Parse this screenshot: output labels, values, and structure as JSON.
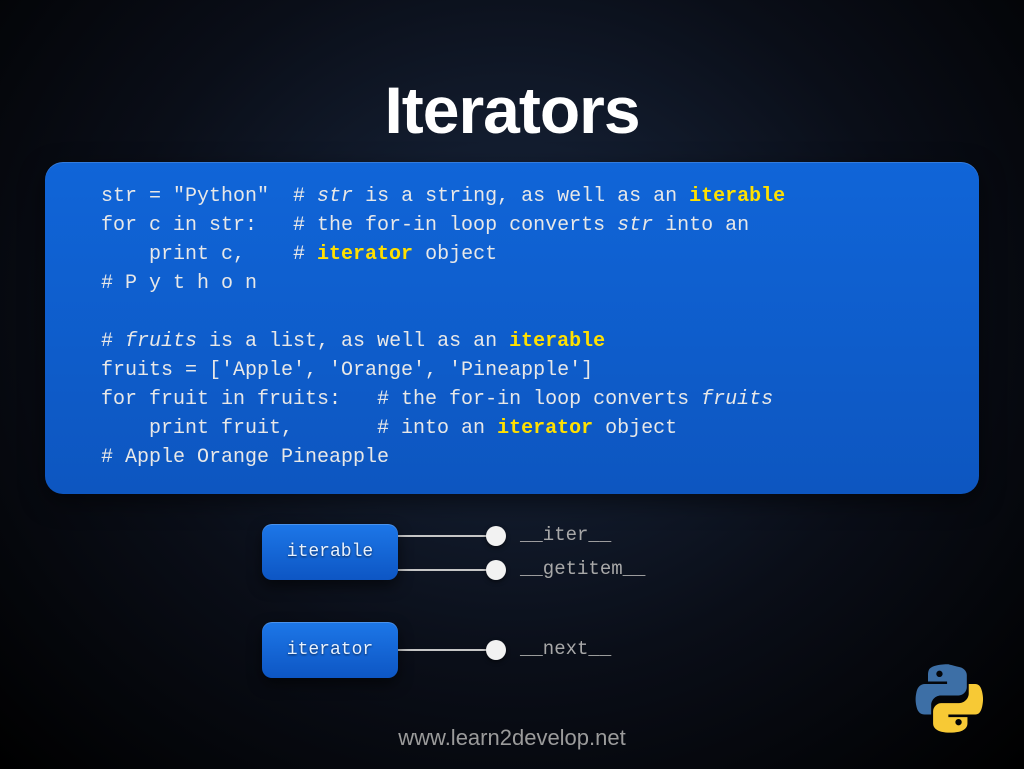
{
  "title": "Iterators",
  "code": {
    "l1a": "str = \"Python\"  # ",
    "l1b": "str",
    "l1c": " is a string, as well as an ",
    "l1d": "iterable",
    "l2a": "for c in str:   # the for-in loop converts ",
    "l2b": "str",
    "l2c": " into an",
    "l3a": "    print c,    # ",
    "l3b": "iterator",
    "l3c": " object",
    "l4": "# P y t h o n",
    "l5": " ",
    "l6a": "# ",
    "l6b": "fruits",
    "l6c": " is a list, as well as an ",
    "l6d": "iterable",
    "l7": "fruits = ['Apple', 'Orange', 'Pineapple']",
    "l8a": "for fruit in fruits:   # the for-in loop converts ",
    "l8b": "fruits",
    "l9a": "    print fruit,       # into an ",
    "l9b": "iterator",
    "l9c": " object",
    "l10": "# Apple Orange Pineapple"
  },
  "diagram": {
    "node1": "iterable",
    "node2": "iterator",
    "methods": {
      "m1": "__iter__",
      "m2": "__getitem__",
      "m3": "__next__"
    }
  },
  "footer": "www.learn2develop.net"
}
